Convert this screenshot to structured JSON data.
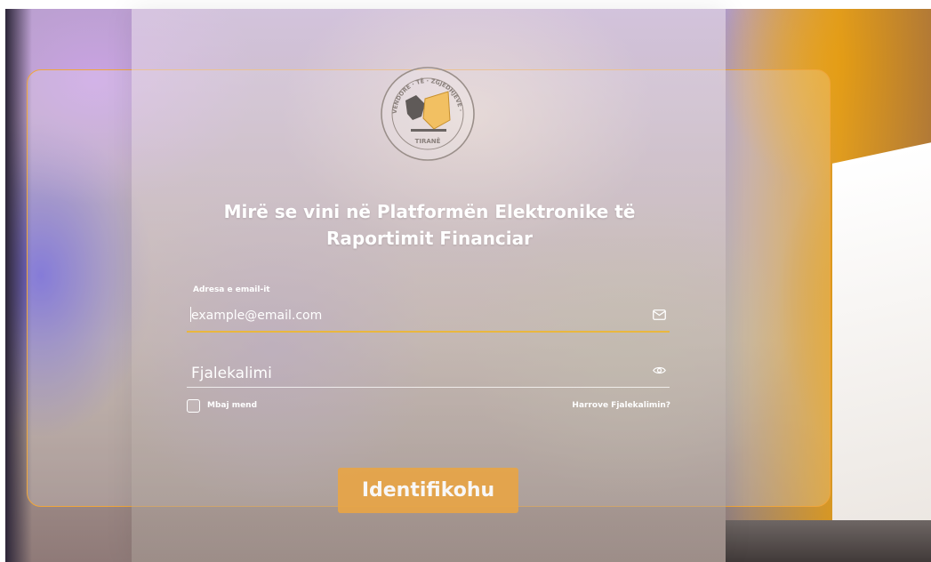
{
  "header": {
    "welcome_line1": "Mirë se vini në Platformën Elektronike të",
    "welcome_line2": "Raportimit Financiar"
  },
  "seal": {
    "text_arc": "VENDORE · TË · ZGJEDHJEVE · KOMISIONI",
    "city": "TIRANË"
  },
  "form": {
    "email_label": "Adresa e email-it",
    "email_placeholder": "example@email.com",
    "password_placeholder": "Fjalekalimi",
    "remember_label": "Mbaj mend",
    "forgot_label": "Harrove Fjalekalimin?",
    "submit_label": "Identifikohu"
  },
  "colors": {
    "accent": "#e8a547",
    "underline_active": "#e9b73f",
    "outer_border": "#f0a63c"
  },
  "icons": {
    "email_icon": "envelope",
    "password_icon": "eye"
  }
}
